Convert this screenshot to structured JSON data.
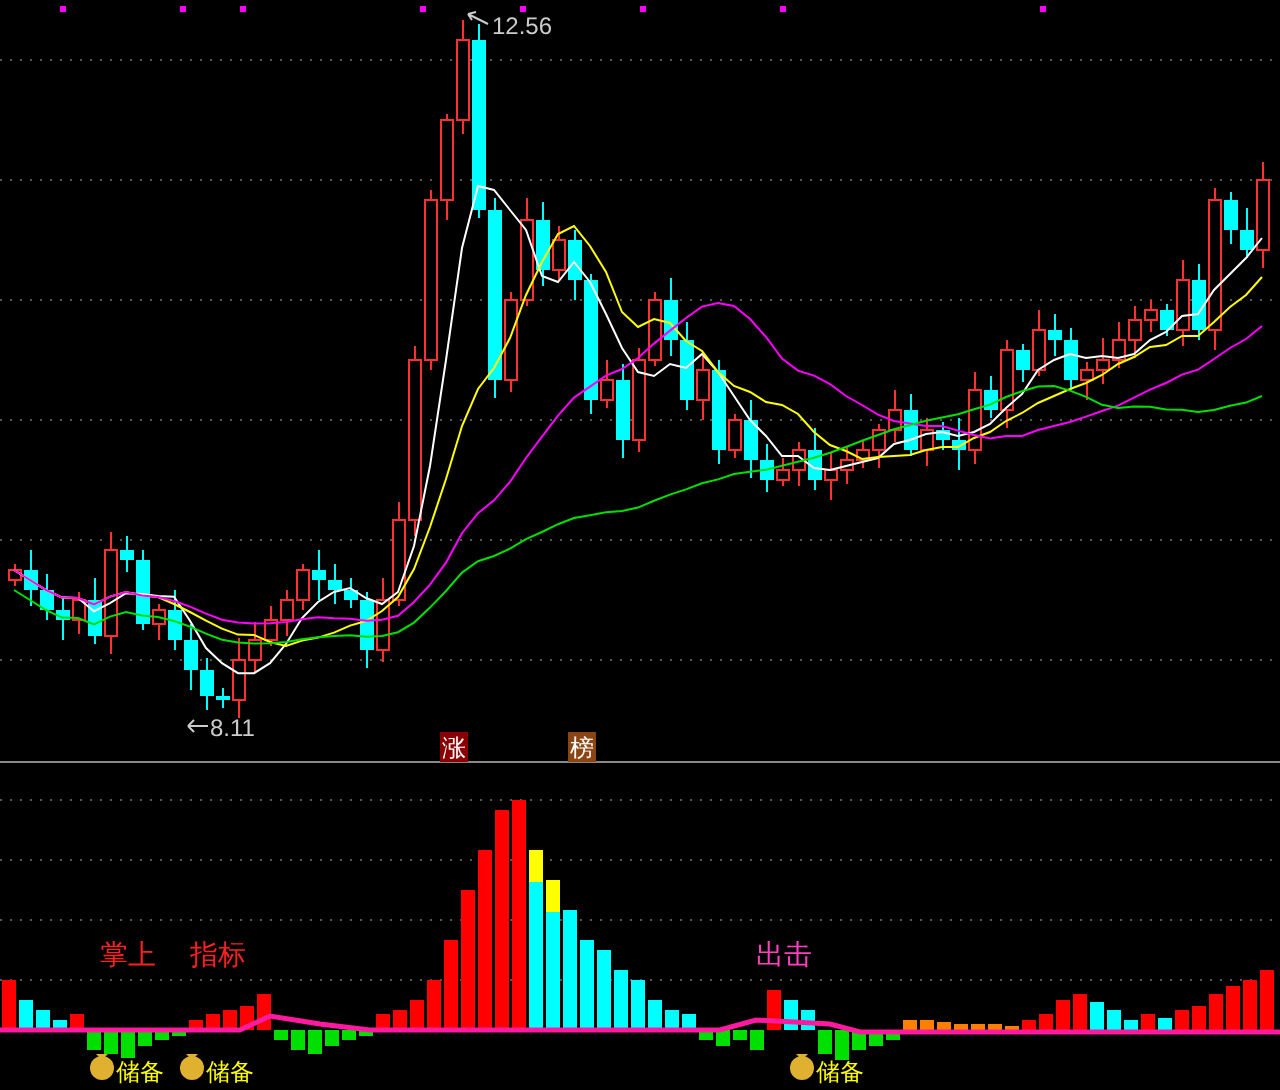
{
  "price_chart": {
    "high_label": "12.56",
    "low_label": "8.11",
    "badges": [
      {
        "text": "涨",
        "color": "#8b0000"
      },
      {
        "text": "榜",
        "color": "#8b4513"
      }
    ]
  },
  "indicator": {
    "labels": [
      {
        "text": "掌上",
        "color": "#ff2020"
      },
      {
        "text": "指标",
        "color": "#ff2020"
      },
      {
        "text": "出击",
        "color": "#ff40c0"
      }
    ],
    "signals": [
      {
        "text": "储备"
      },
      {
        "text": "储备"
      },
      {
        "text": "储备"
      }
    ]
  }
}
